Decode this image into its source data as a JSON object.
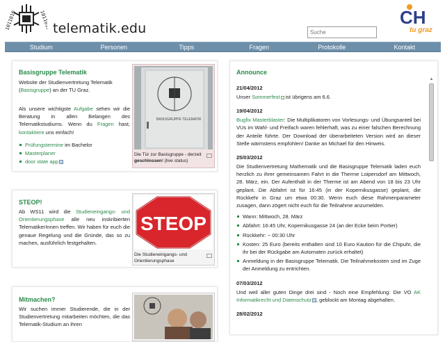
{
  "header": {
    "site_title": "telematik.edu",
    "logo_text": "1011010",
    "ch_logo_text": "CH",
    "ch_logo_sub": "tu graz"
  },
  "search": {
    "placeholder": "Suche"
  },
  "nav": {
    "items": [
      "Studium",
      "Personen",
      "Tipps",
      "Fragen",
      "Protokolle",
      "Kontakt"
    ]
  },
  "basisgruppe": {
    "heading": "Basisgruppe Telematik",
    "p1_a": "Website der Studienvertretung Telematik (",
    "p1_link": "Basisgruppe",
    "p1_b": ") an der TU Graz.",
    "p2_a": "Als unsere wichtigste ",
    "p2_link1": "Aufgabe",
    "p2_b": " sehen wir die Beratung in allen Belangen des Telematikstudiums. Wenn du ",
    "p2_link2": "Fragen",
    "p2_c": " hast, ",
    "p2_link3": "kontaktiere",
    "p2_d": " uns einfach!",
    "links": [
      "Prüfungstermine",
      "Masterplaner",
      "door state app"
    ],
    "link0_suffix": " im Bachelor",
    "image_caption_a": "Die Tür zur Basisgruppe - derzeit ",
    "image_caption_bold": "geschlossen",
    "image_caption_b": "! (live status)",
    "door_sign": "BASISGRUPPE TELEMATIK"
  },
  "steop": {
    "heading": "STEOP!",
    "p_a": "Ab WS11 wird die ",
    "p_link": "Studieneingangs- und Orientierungsphase",
    "p_b": " alle neu inskribierten TelematikerInnen treffen. Wir haben für euch die genaue Regelung und die Gründe, das so zu machen, ausführlich festgehalten.",
    "sign_text": "STEOP",
    "caption": "Die Studieneingangs- und Orientierungsphase"
  },
  "mitmachen": {
    "heading": "Mitmachen?",
    "p": "Wir suchen immer Studierende, die in der Studienvertretung mitarbeiten möchten, die das Telematik-Studium an ihren"
  },
  "announce": {
    "heading": "Announce",
    "entries": [
      {
        "date": "21/04/2012",
        "a": "Unser ",
        "link": "Sommerfest",
        "b": " ist übrigens am 6.6."
      },
      {
        "date": "19/04/2012",
        "link": "Bugfix Masterblaster",
        "b": ": Die Multiplikatoren von Vorlesungs- und Übungsanteil bei VUs im Wahl- und Freifach waren fehlerhaft, was zu einer falschen Berechnung der Anteile führte. Der Download der überarbeiteten Version wird an dieser Stelle wärmstens empfohlen! Danke an Michael für den Hinweis."
      },
      {
        "date": "25/03/2012",
        "b": "Die Studienvertretung Mathematik und die Basisgruppe Telematik laden euch herzlich zu ihrer gemeinsamen Fahrt in die Therme Loipersdorf am Mittwoch, 28. März, ein. Der Aufenthalt in der Therme ist am Abend von 18 bis 23 Uhr geplant. Die Abfahrt ist für 16:45 (in der Kopernikusgasse) geplant, die Rückkehr in Graz um etwa 00:30. Wenn euch diese Rahmenparameter zusagen, dann zögert nicht euch für die Teilnahme anzumelden."
      }
    ],
    "bullets": [
      "Wann: Mittwoch, 28. März",
      "Abfahrt: 16:45 Uhr, Kopernikusgasse 24 (an der Ecke beim Portier)",
      "Rückkehr: ~ 00:30 Uhr",
      "Kosten: 25 Euro (bereits enthalten sind 10 Euro Kaution für die Chipuhr, die ihr bei der Rückgabe am Automaten zurück erhaltet)",
      "Anmeldung in der Basisgruppe Telematik. Die Teilnahmekosten sind im Zuge der Anmeldung zu entrichten."
    ],
    "entry4": {
      "date": "07/03/2012",
      "a": "Und weil aller guten Dinge drei sind - Noch eine Empfehlung: Die VO ",
      "link": "AK Informatikrecht und Datenschutz",
      "b": ", geblockt am Montag abgehalten."
    },
    "entry5_date": "28/02/2012"
  },
  "colors": {
    "accent": "#2a8a4a",
    "nav": "#6e8faa"
  }
}
